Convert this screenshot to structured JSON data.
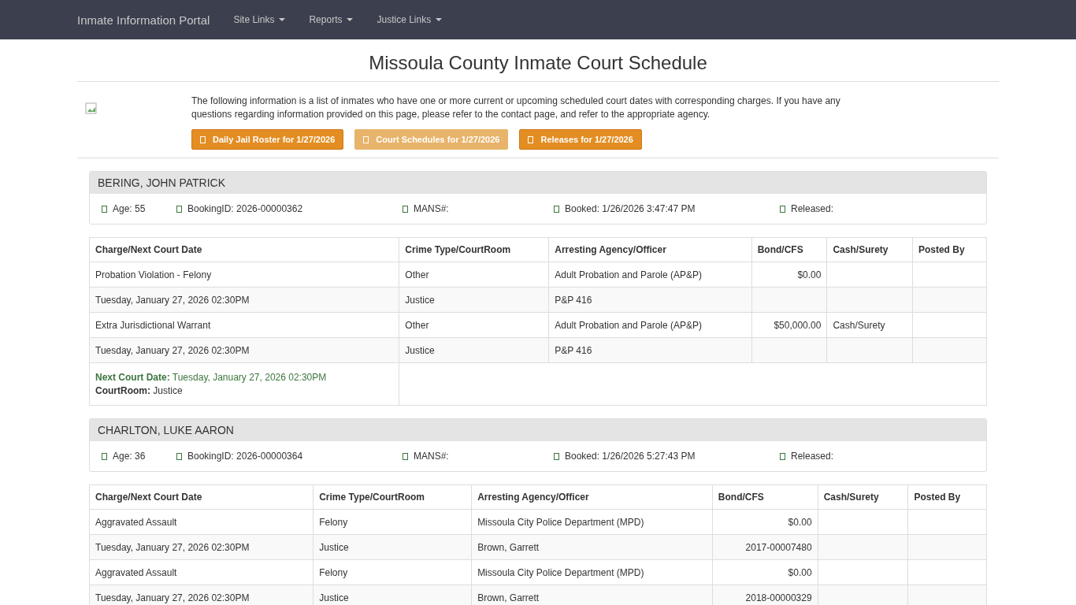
{
  "navbar": {
    "brand": "Inmate Information Portal",
    "menus": [
      {
        "label": "Site Links"
      },
      {
        "label": "Reports"
      },
      {
        "label": "Justice Links"
      }
    ]
  },
  "page_title": "Missoula County Inmate Court Schedule",
  "intro": "The following information is a list of inmates who have one or more current or upcoming scheduled court dates with corresponding charges. If you have any questions regarding information provided on this page, please refer to the contact page, and refer to the appropriate agency.",
  "buttons": [
    {
      "label": "Daily Jail Roster for 1/27/2026",
      "selected": false
    },
    {
      "label": "Court Schedules for 1/27/2026",
      "selected": true
    },
    {
      "label": "Releases for 1/27/2026",
      "selected": false
    }
  ],
  "inmates": [
    {
      "name": "BERING, JOHN PATRICK",
      "details": [
        "Age: 55",
        "BookingID: 2026-00000362",
        "MANS#:",
        "Booked: 1/26/2026 3:47:47 PM",
        "Released:"
      ],
      "columns": [
        "Charge/Next Court Date",
        "Crime Type/CourtRoom",
        "Arresting Agency/Officer",
        "Bond/CFS",
        "Cash/Surety",
        "Posted By"
      ],
      "rows": [
        [
          "Probation Violation - Felony",
          "Other",
          "Adult Probation and Parole (AP&P)",
          "$0.00",
          "",
          ""
        ],
        [
          "Tuesday, January 27, 2026 02:30PM",
          "Justice",
          "P&P 416",
          "",
          "",
          ""
        ],
        [
          "Extra Jurisdictional Warrant",
          "Other",
          "Adult Probation and Parole (AP&P)",
          "$50,000.00",
          "Cash/Surety",
          ""
        ],
        [
          "Tuesday, January 27, 2026 02:30PM",
          "Justice",
          "P&P 416",
          "",
          "",
          ""
        ]
      ],
      "next_court": {
        "date_label": "Next Court Date:",
        "date": "Tuesday, January 27, 2026 02:30PM",
        "room_label": "CourtRoom:",
        "room": "Justice"
      }
    },
    {
      "name": "CHARLTON, LUKE AARON",
      "details": [
        "Age: 36",
        "BookingID: 2026-00000364",
        "MANS#:",
        "Booked: 1/26/2026 5:27:43 PM",
        "Released:"
      ],
      "columns": [
        "Charge/Next Court Date",
        "Crime Type/CourtRoom",
        "Arresting Agency/Officer",
        "Bond/CFS",
        "Cash/Surety",
        "Posted By"
      ],
      "rows": [
        [
          "Aggravated Assault",
          "Felony",
          "Missoula City Police Department (MPD)",
          "$0.00",
          "",
          ""
        ],
        [
          "Tuesday, January 27, 2026 02:30PM",
          "Justice",
          "Brown, Garrett",
          "2017-00007480",
          "",
          ""
        ],
        [
          "Aggravated Assault",
          "Felony",
          "Missoula City Police Department (MPD)",
          "$0.00",
          "",
          ""
        ],
        [
          "Tuesday, January 27, 2026 02:30PM",
          "Justice",
          "Brown, Garrett",
          "2018-00000329",
          "",
          ""
        ]
      ]
    }
  ]
}
